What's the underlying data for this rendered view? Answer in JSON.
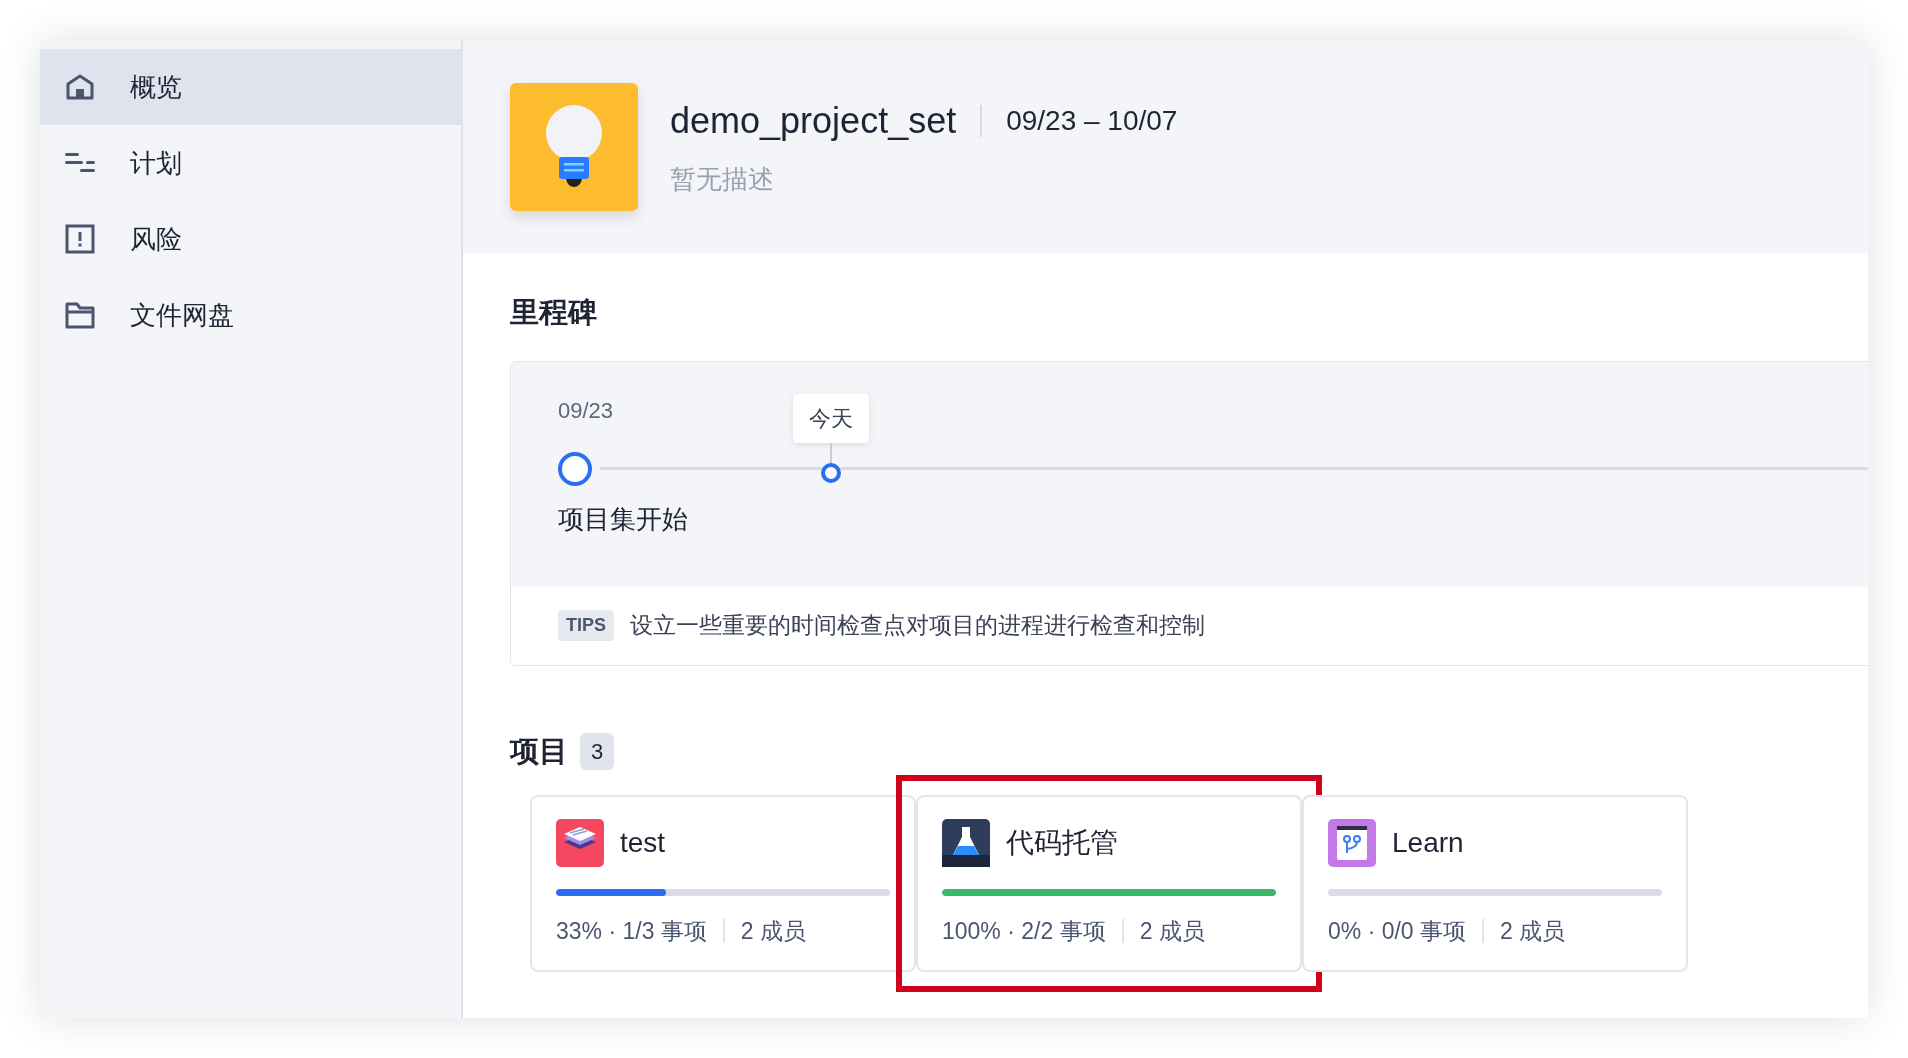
{
  "sidebar": {
    "items": [
      {
        "label": "概览",
        "kind": "home",
        "selected": true
      },
      {
        "label": "计划",
        "kind": "plan",
        "selected": false
      },
      {
        "label": "风险",
        "kind": "risk",
        "selected": false
      },
      {
        "label": "文件网盘",
        "kind": "folder",
        "selected": false
      }
    ]
  },
  "header": {
    "title": "demo_project_set",
    "date_range": "09/23 – 10/07",
    "description": "暂无描述"
  },
  "milestones": {
    "title": "里程碑",
    "start_date": "09/23",
    "today_label": "今天",
    "start_label": "项目集开始",
    "tips": {
      "badge": "TIPS",
      "text": "设立一些重要的时间检查点对项目的进程进行检查和控制"
    }
  },
  "projects": {
    "title": "项目",
    "count": "3",
    "items": [
      {
        "name": "test",
        "kind": "layers",
        "level": 0.33,
        "color": "#2a6ff0",
        "progress": "33% · 1/3 事项",
        "members": "2 成员",
        "highlighted": false
      },
      {
        "name": "代码托管",
        "kind": "flask",
        "level": 1,
        "color": "#3bb86b",
        "progress": "100% · 2/2 事项",
        "members": "2 成员",
        "highlighted": true
      },
      {
        "name": "Learn",
        "kind": "branch",
        "level": 0,
        "progress": "0% · 0/0 事项",
        "members": "2 成员",
        "highlighted": false
      }
    ]
  }
}
